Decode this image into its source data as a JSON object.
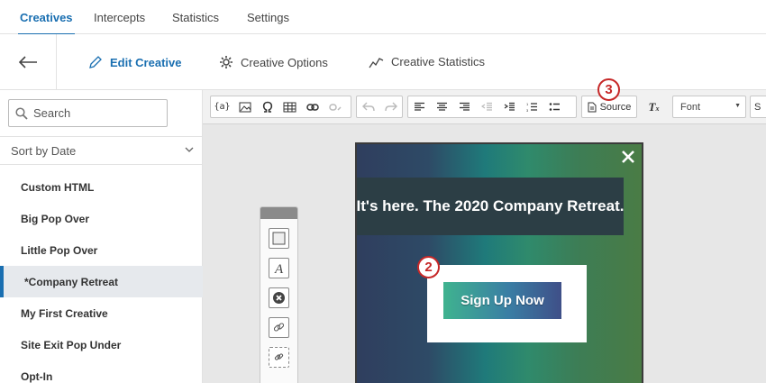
{
  "topnav": {
    "tabs": [
      {
        "label": "Creatives",
        "active": true
      },
      {
        "label": "Intercepts",
        "active": false
      },
      {
        "label": "Statistics",
        "active": false
      },
      {
        "label": "Settings",
        "active": false
      }
    ]
  },
  "subnav": {
    "back_icon": "arrow-left-icon",
    "items": [
      {
        "label": "Edit Creative",
        "icon": "pencil-icon",
        "active": true
      },
      {
        "label": "Creative Options",
        "icon": "gear-icon",
        "active": false
      },
      {
        "label": "Creative Statistics",
        "icon": "trend-line-icon",
        "active": false
      }
    ]
  },
  "sidebar": {
    "search_placeholder": "Search",
    "sort_label": "Sort by Date",
    "items": [
      {
        "label": "Custom HTML",
        "selected": false
      },
      {
        "label": "Big Pop Over",
        "selected": false
      },
      {
        "label": "Little Pop Over",
        "selected": false
      },
      {
        "label": "*Company Retreat",
        "selected": true
      },
      {
        "label": "My First Creative",
        "selected": false
      },
      {
        "label": "Site Exit Pop Under",
        "selected": false
      },
      {
        "label": "Opt-In",
        "selected": false
      }
    ]
  },
  "toolbar": {
    "piped_text_label": "{a}",
    "source_label": "Source",
    "font_label": "Font",
    "size_label": "S"
  },
  "badges": {
    "source": "3",
    "button": "2"
  },
  "creative": {
    "headline": "It's here. The 2020 Company Retreat.",
    "button_label": "Sign Up Now"
  },
  "colors": {
    "accent": "#1a6fb1",
    "badge": "#c62828"
  }
}
